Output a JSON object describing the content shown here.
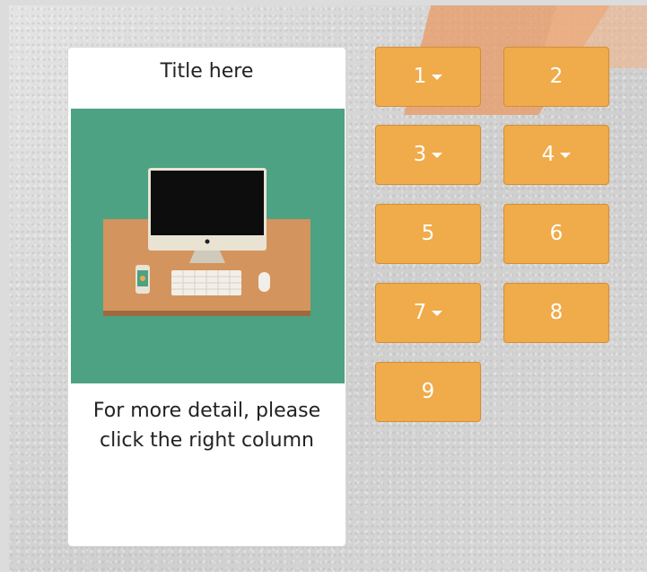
{
  "card": {
    "title": "Title here",
    "description": "For more detail, please click the right column",
    "image_bg_color": "#4ca283"
  },
  "buttons": [
    {
      "label": "1",
      "has_dropdown": true
    },
    {
      "label": "2",
      "has_dropdown": false
    },
    {
      "label": "3",
      "has_dropdown": true
    },
    {
      "label": "4",
      "has_dropdown": true
    },
    {
      "label": "5",
      "has_dropdown": false
    },
    {
      "label": "6",
      "has_dropdown": false
    },
    {
      "label": "7",
      "has_dropdown": true
    },
    {
      "label": "8",
      "has_dropdown": false
    },
    {
      "label": "9",
      "has_dropdown": false
    }
  ],
  "colors": {
    "button_bg": "#f0ab4a",
    "button_border": "#d48e36",
    "accent_stripe": "#e89a63"
  }
}
